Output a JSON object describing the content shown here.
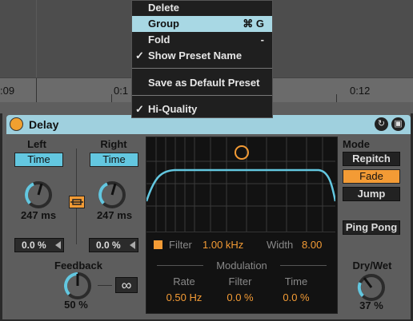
{
  "timeline": {
    "labels": [
      ":09",
      "0:1",
      "0:12"
    ]
  },
  "menu": {
    "items": [
      {
        "label": "Delete",
        "shortcut": "",
        "check": ""
      },
      {
        "label": "Group",
        "shortcut": "⌘ G",
        "check": ""
      },
      {
        "label": "Fold",
        "shortcut": "-",
        "check": ""
      },
      {
        "label": "Show Preset Name",
        "shortcut": "",
        "check": "✓"
      },
      {
        "label": "Save as Default Preset",
        "shortcut": "",
        "check": ""
      },
      {
        "label": "Hi-Quality",
        "shortcut": "",
        "check": "✓"
      }
    ]
  },
  "device": {
    "title": "Delay",
    "left": {
      "label": "Left",
      "mode": "Time",
      "value": "247 ms",
      "offset": "0.0 %",
      "knob_level": 0.35
    },
    "right": {
      "label": "Right",
      "mode": "Time",
      "value": "247 ms",
      "offset": "0.0 %",
      "knob_level": 0.35
    },
    "feedback": {
      "label": "Feedback",
      "value": "50 %",
      "knob_level": 0.5,
      "freeze_icon": "infinity-icon"
    },
    "filter": {
      "label": "Filter",
      "freq": "1.00 kHz",
      "width_label": "Width",
      "width": "8.00"
    },
    "modulation": {
      "label": "Modulation",
      "rate_label": "Rate",
      "rate": "0.50 Hz",
      "filter_label": "Filter",
      "filter": "0.0 %",
      "time_label": "Time",
      "time": "0.0 %"
    },
    "mode": {
      "label": "Mode",
      "options": [
        "Repitch",
        "Fade",
        "Jump"
      ],
      "selected": "Fade"
    },
    "ping_pong": "Ping Pong",
    "drywet": {
      "label": "Dry/Wet",
      "value": "37 %",
      "knob_level": 0.37
    }
  },
  "colors": {
    "accent": "#f39b35",
    "blue": "#63c7e0",
    "title": "#9fd0de"
  }
}
